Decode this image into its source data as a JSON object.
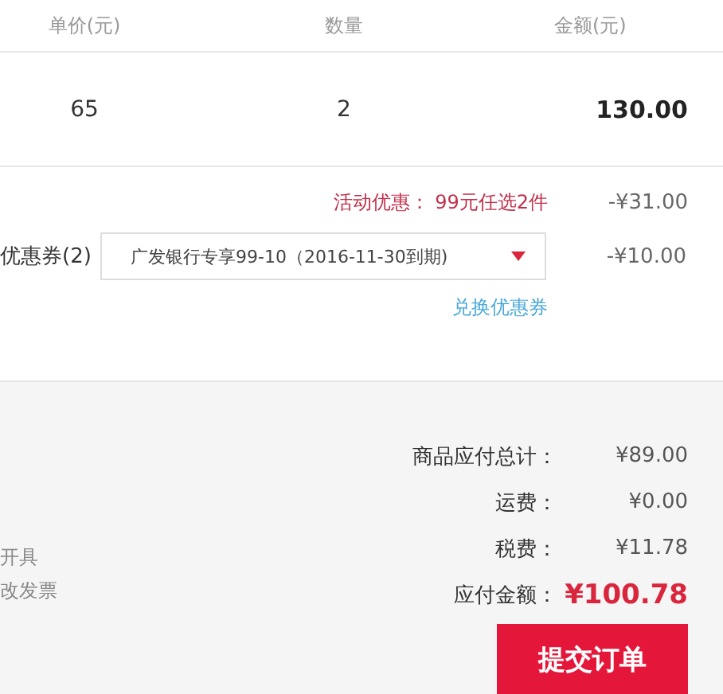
{
  "table": {
    "columns": [
      "单价(元)",
      "数量",
      "金额(元)"
    ],
    "rows": [
      {
        "unit_price": "65",
        "quantity": "2",
        "amount": "130.00"
      }
    ]
  },
  "discounts": {
    "promotion": {
      "label": "活动优惠： 99元任选2件",
      "amount": "-¥31.00"
    },
    "coupon": {
      "label": "优惠券(2)",
      "value": "广发银行专享99-10（2016-11-30到期)",
      "amount": "-¥10.00",
      "link": "兑换优惠券"
    }
  },
  "invoice": {
    "lines": [
      "开具",
      "改发票"
    ]
  },
  "summary": [
    {
      "label": "商品应付总计：",
      "value": "¥89.00",
      "kind": "normal"
    },
    {
      "label": "运费：",
      "value": "¥0.00",
      "kind": "normal"
    },
    {
      "label": "税费：",
      "value": "¥11.78",
      "kind": "normal"
    },
    {
      "label": "应付金额：",
      "value": "¥100.78",
      "kind": "total"
    }
  ],
  "submit_button": "提交订单"
}
